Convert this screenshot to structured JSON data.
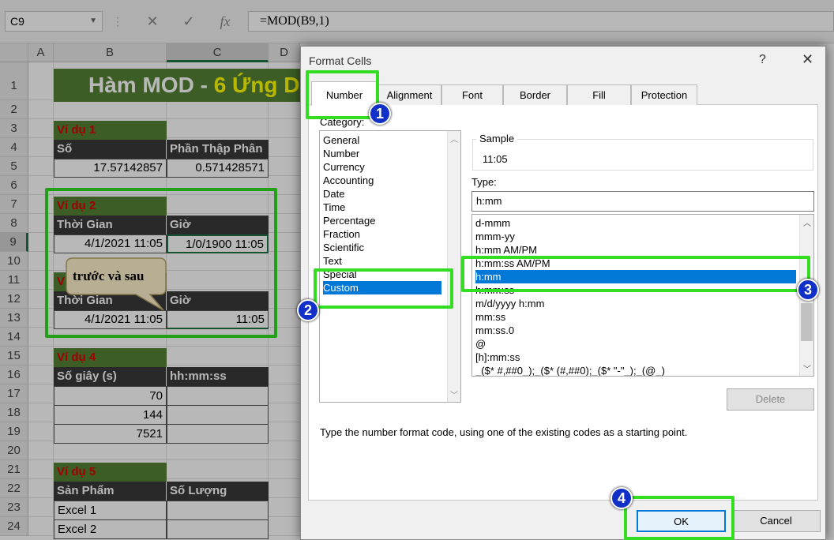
{
  "name_box": "C9",
  "formula": "=MOD(B9,1)",
  "formula_icons": {
    "cancel": "✕",
    "enter": "✓",
    "fx": "fx"
  },
  "columns": [
    "A",
    "B",
    "C",
    "D"
  ],
  "rows": [
    "1",
    "2",
    "3",
    "4",
    "5",
    "6",
    "7",
    "8",
    "9",
    "10",
    "11",
    "12",
    "13",
    "14",
    "15",
    "16",
    "17",
    "18",
    "19",
    "20",
    "21",
    "22",
    "23",
    "24"
  ],
  "sheet": {
    "title_white": "Hàm MOD - ",
    "title_yellow": "6 Ứng D",
    "ex1": {
      "label": "Ví dụ 1",
      "h1": "Số",
      "h2": "Phần Thập Phân",
      "v1": "17.57142857",
      "v2": "0.571428571"
    },
    "ex2": {
      "label": "Ví dụ 2",
      "h1": "Thời Gian",
      "h2": "Giờ",
      "v1": "4/1/2021 11:05",
      "v2": "1/0/1900 11:05"
    },
    "ex3": {
      "label": "Ví",
      "h1": "Thời Gian",
      "h2": "Giờ",
      "v1": "4/1/2021 11:05",
      "v2": "11:05"
    },
    "callout": "trước và sau",
    "ex4": {
      "label": "Ví dụ 4",
      "h1": "Số giây (s)",
      "h2": "hh:mm:ss",
      "values": [
        "70",
        "144",
        "7521"
      ]
    },
    "ex5": {
      "label": "Ví dụ 5",
      "h1": "Sản Phẩm",
      "h2": "Số Lượng",
      "items": [
        "Excel 1",
        "Excel 2"
      ]
    }
  },
  "dialog": {
    "title": "Format Cells",
    "help": "?",
    "close": "✕",
    "tabs": [
      "Number",
      "Alignment",
      "Font",
      "Border",
      "Fill",
      "Protection"
    ],
    "category_label": "Category:",
    "categories": [
      "General",
      "Number",
      "Currency",
      "Accounting",
      "Date",
      "Time",
      "Percentage",
      "Fraction",
      "Scientific",
      "Text",
      "Special",
      "Custom"
    ],
    "selected_category": "Custom",
    "sample_label": "Sample",
    "sample_value": "11:05",
    "type_label": "Type:",
    "type_value": "h:mm",
    "formats": [
      "d-mmm",
      "mmm-yy",
      "h:mm AM/PM",
      "h:mm:ss AM/PM",
      "h:mm",
      "h:mm:ss",
      "m/d/yyyy h:mm",
      "mm:ss",
      "mm:ss.0",
      "@",
      "[h]:mm:ss",
      "_($* #,##0_);_($* (#,##0);_($* \"-\"_);_(@_)"
    ],
    "selected_format": "h:mm",
    "delete_button": "Delete",
    "hint": "Type the number format code, using one of the existing codes as a starting point.",
    "ok_button": "OK",
    "cancel_button": "Cancel"
  },
  "badges": [
    "1",
    "2",
    "3",
    "4"
  ],
  "colors": {
    "highlight": "#33dd22",
    "badge": "#1030c8",
    "selection": "#0078d7",
    "example_label_bg": "#548235",
    "header_bg": "#3a3a3a"
  }
}
